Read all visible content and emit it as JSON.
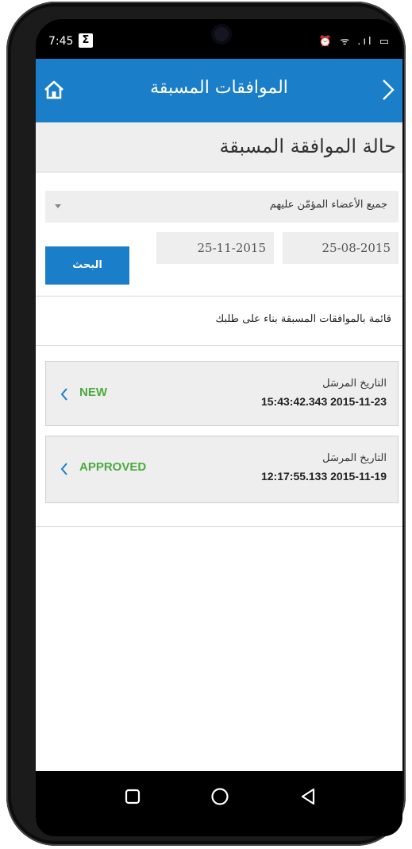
{
  "status_bar": {
    "time": "7:45",
    "sigma": "Σ",
    "icons_text": "⏰ ᯤ .ıl ▭"
  },
  "appbar": {
    "title": "الموافقات المسبقة",
    "color": "#1a7ec8"
  },
  "section": {
    "title": "حالة الموافقة المسبقة"
  },
  "filters": {
    "member_select_value": "جميع الأعضاء المؤمّن عليهم",
    "date_from": "25-08-2015",
    "date_to": "25-11-2015",
    "search_label": "البحث"
  },
  "list": {
    "caption": "قائمة بالموافقات المسبقة بناء على طلبك",
    "items": [
      {
        "status": "NEW",
        "date_label": "التاريخ المرسَل",
        "date_value": "15:43:42.343 2015-11-23"
      },
      {
        "status": "APPROVED",
        "date_label": "التاريخ المرسَل",
        "date_value": "12:17:55.133 2015-11-19"
      }
    ]
  },
  "colors": {
    "accent": "#1a7ec8",
    "status_green": "#4aab3f",
    "panel": "#eeeeee"
  }
}
